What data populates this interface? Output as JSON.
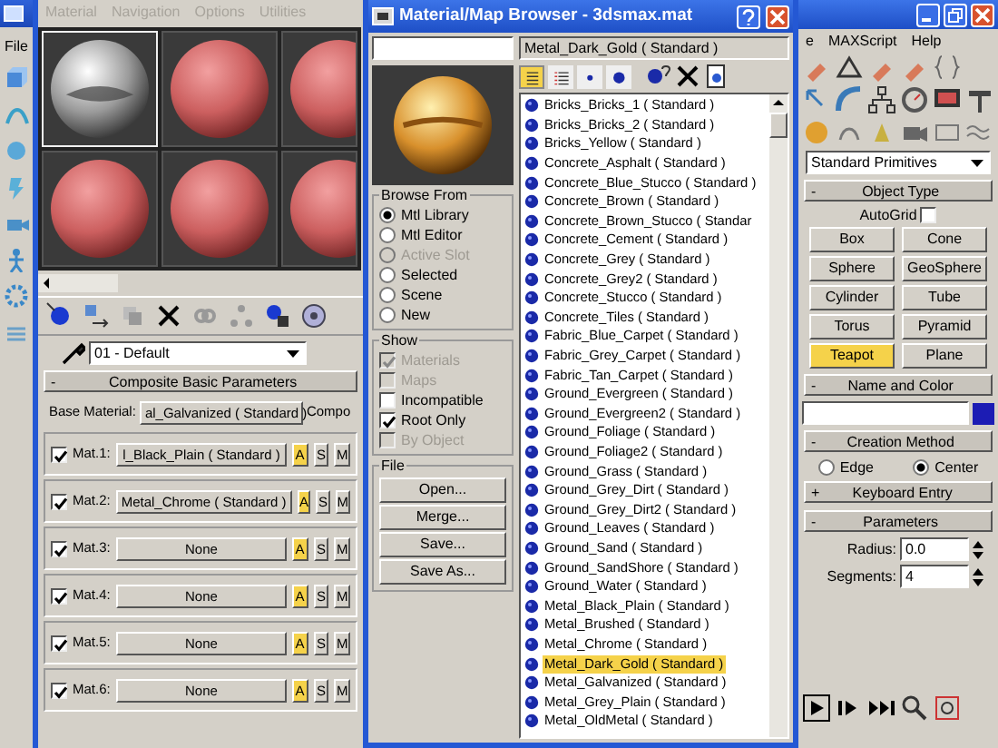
{
  "main_window": {
    "left_menu": [
      "File"
    ],
    "right_menu": [
      "e",
      "MAXScript",
      "Help"
    ]
  },
  "material_editor": {
    "menu": [
      "Material",
      "Navigation",
      "Options",
      "Utilities"
    ],
    "slots": [
      {
        "kind": "chrome",
        "selected": true
      },
      {
        "kind": "plain",
        "selected": false
      },
      {
        "kind": "plain",
        "selected": false
      },
      {
        "kind": "plain",
        "selected": false
      },
      {
        "kind": "plain",
        "selected": false
      },
      {
        "kind": "plain",
        "selected": false
      }
    ],
    "material_name": "01 - Default",
    "rollout": {
      "sign": "-",
      "title": "Composite Basic Parameters"
    },
    "base_label": "Base Material:",
    "base_value": "al_Galvanized ( Standard )",
    "column_3": "Compo",
    "mats": [
      {
        "label": "Mat.1:",
        "checked": true,
        "material": "l_Black_Plain ( Standard )",
        "modes": [
          {
            "label": "A",
            "selected": true
          },
          {
            "label": "S",
            "selected": false
          },
          {
            "label": "M",
            "selected": false
          }
        ]
      },
      {
        "label": "Mat.2:",
        "checked": true,
        "material": "Metal_Chrome ( Standard )",
        "modes": [
          {
            "label": "A",
            "selected": true
          },
          {
            "label": "S",
            "selected": false
          },
          {
            "label": "M",
            "selected": false
          }
        ]
      },
      {
        "label": "Mat.3:",
        "checked": true,
        "material": "None",
        "modes": [
          {
            "label": "A",
            "selected": true
          },
          {
            "label": "S",
            "selected": false
          },
          {
            "label": "M",
            "selected": false
          }
        ]
      },
      {
        "label": "Mat.4:",
        "checked": true,
        "material": "None",
        "modes": [
          {
            "label": "A",
            "selected": true
          },
          {
            "label": "S",
            "selected": false
          },
          {
            "label": "M",
            "selected": false
          }
        ]
      },
      {
        "label": "Mat.5:",
        "checked": true,
        "material": "None",
        "modes": [
          {
            "label": "A",
            "selected": true
          },
          {
            "label": "S",
            "selected": false
          },
          {
            "label": "M",
            "selected": false
          }
        ]
      },
      {
        "label": "Mat.6:",
        "checked": true,
        "material": "None",
        "modes": [
          {
            "label": "A",
            "selected": true
          },
          {
            "label": "S",
            "selected": false
          },
          {
            "label": "M",
            "selected": false
          }
        ]
      }
    ]
  },
  "browser": {
    "title": "Material/Map Browser - 3dsmax.mat",
    "current": "Metal_Dark_Gold ( Standard )",
    "view_modes": [
      {
        "kind": "list",
        "selected": true
      },
      {
        "kind": "list-icons",
        "selected": false
      },
      {
        "kind": "small-icons",
        "selected": false
      },
      {
        "kind": "large-icons",
        "selected": false
      }
    ],
    "browse_from": {
      "title": "Browse From",
      "options": [
        {
          "label": "Mtl Library",
          "selected": true,
          "disabled": false
        },
        {
          "label": "Mtl Editor",
          "selected": false,
          "disabled": false
        },
        {
          "label": "Active Slot",
          "selected": false,
          "disabled": true
        },
        {
          "label": "Selected",
          "selected": false,
          "disabled": false
        },
        {
          "label": "Scene",
          "selected": false,
          "disabled": false
        },
        {
          "label": "New",
          "selected": false,
          "disabled": false
        }
      ]
    },
    "show": {
      "title": "Show",
      "options": [
        {
          "label": "Materials",
          "checked": true,
          "disabled": true
        },
        {
          "label": "Maps",
          "checked": false,
          "disabled": true
        },
        {
          "label": "Incompatible",
          "checked": false,
          "disabled": false
        },
        {
          "label": "Root Only",
          "checked": true,
          "disabled": false
        },
        {
          "label": "By Object",
          "checked": false,
          "disabled": true
        }
      ]
    },
    "file": {
      "title": "File",
      "buttons": [
        "Open...",
        "Merge...",
        "Save...",
        "Save As..."
      ]
    },
    "items": [
      {
        "label": "Bricks_Bricks_1 ( Standard )",
        "selected": false
      },
      {
        "label": "Bricks_Bricks_2 ( Standard )",
        "selected": false
      },
      {
        "label": "Bricks_Yellow ( Standard )",
        "selected": false
      },
      {
        "label": "Concrete_Asphalt ( Standard )",
        "selected": false
      },
      {
        "label": "Concrete_Blue_Stucco ( Standard )",
        "selected": false
      },
      {
        "label": "Concrete_Brown ( Standard )",
        "selected": false
      },
      {
        "label": "Concrete_Brown_Stucco ( Standar",
        "selected": false
      },
      {
        "label": "Concrete_Cement ( Standard )",
        "selected": false
      },
      {
        "label": "Concrete_Grey ( Standard )",
        "selected": false
      },
      {
        "label": "Concrete_Grey2 ( Standard )",
        "selected": false
      },
      {
        "label": "Concrete_Stucco ( Standard )",
        "selected": false
      },
      {
        "label": "Concrete_Tiles ( Standard )",
        "selected": false
      },
      {
        "label": "Fabric_Blue_Carpet ( Standard )",
        "selected": false
      },
      {
        "label": "Fabric_Grey_Carpet ( Standard )",
        "selected": false
      },
      {
        "label": "Fabric_Tan_Carpet ( Standard )",
        "selected": false
      },
      {
        "label": "Ground_Evergreen ( Standard )",
        "selected": false
      },
      {
        "label": "Ground_Evergreen2 ( Standard )",
        "selected": false
      },
      {
        "label": "Ground_Foliage ( Standard )",
        "selected": false
      },
      {
        "label": "Ground_Foliage2 ( Standard )",
        "selected": false
      },
      {
        "label": "Ground_Grass ( Standard )",
        "selected": false
      },
      {
        "label": "Ground_Grey_Dirt ( Standard )",
        "selected": false
      },
      {
        "label": "Ground_Grey_Dirt2 ( Standard )",
        "selected": false
      },
      {
        "label": "Ground_Leaves ( Standard )",
        "selected": false
      },
      {
        "label": "Ground_Sand ( Standard )",
        "selected": false
      },
      {
        "label": "Ground_SandShore ( Standard )",
        "selected": false
      },
      {
        "label": "Ground_Water ( Standard )",
        "selected": false
      },
      {
        "label": "Metal_Black_Plain ( Standard )",
        "selected": false
      },
      {
        "label": "Metal_Brushed ( Standard )",
        "selected": false
      },
      {
        "label": "Metal_Chrome ( Standard )",
        "selected": false
      },
      {
        "label": "Metal_Dark_Gold ( Standard )",
        "selected": true
      },
      {
        "label": "Metal_Galvanized ( Standard )",
        "selected": false
      },
      {
        "label": "Metal_Grey_Plain ( Standard )",
        "selected": false
      },
      {
        "label": "Metal_OldMetal ( Standard )",
        "selected": false
      }
    ]
  },
  "command_panel": {
    "dropdown": "Standard Primitives",
    "object_type": {
      "sign": "-",
      "title": "Object Type",
      "autogrid_label": "AutoGrid",
      "autogrid": false,
      "buttons": [
        {
          "label": "Box",
          "selected": false
        },
        {
          "label": "Cone",
          "selected": false
        },
        {
          "label": "Sphere",
          "selected": false
        },
        {
          "label": "GeoSphere",
          "selected": false
        },
        {
          "label": "Cylinder",
          "selected": false
        },
        {
          "label": "Tube",
          "selected": false
        },
        {
          "label": "Torus",
          "selected": false
        },
        {
          "label": "Pyramid",
          "selected": false
        },
        {
          "label": "Teapot",
          "selected": true
        },
        {
          "label": "Plane",
          "selected": false
        }
      ]
    },
    "name_and_color": {
      "sign": "-",
      "title": "Name and Color",
      "color": "#1c1cb4"
    },
    "creation_method": {
      "sign": "-",
      "title": "Creation Method",
      "options": [
        {
          "label": "Edge",
          "selected": false
        },
        {
          "label": "Center",
          "selected": true
        }
      ]
    },
    "keyboard_entry": {
      "sign": "+",
      "title": "Keyboard Entry"
    },
    "parameters": {
      "sign": "-",
      "title": "Parameters",
      "fields": [
        {
          "label": "Radius:",
          "value": "0.0"
        },
        {
          "label": "Segments:",
          "value": "4"
        }
      ]
    }
  }
}
